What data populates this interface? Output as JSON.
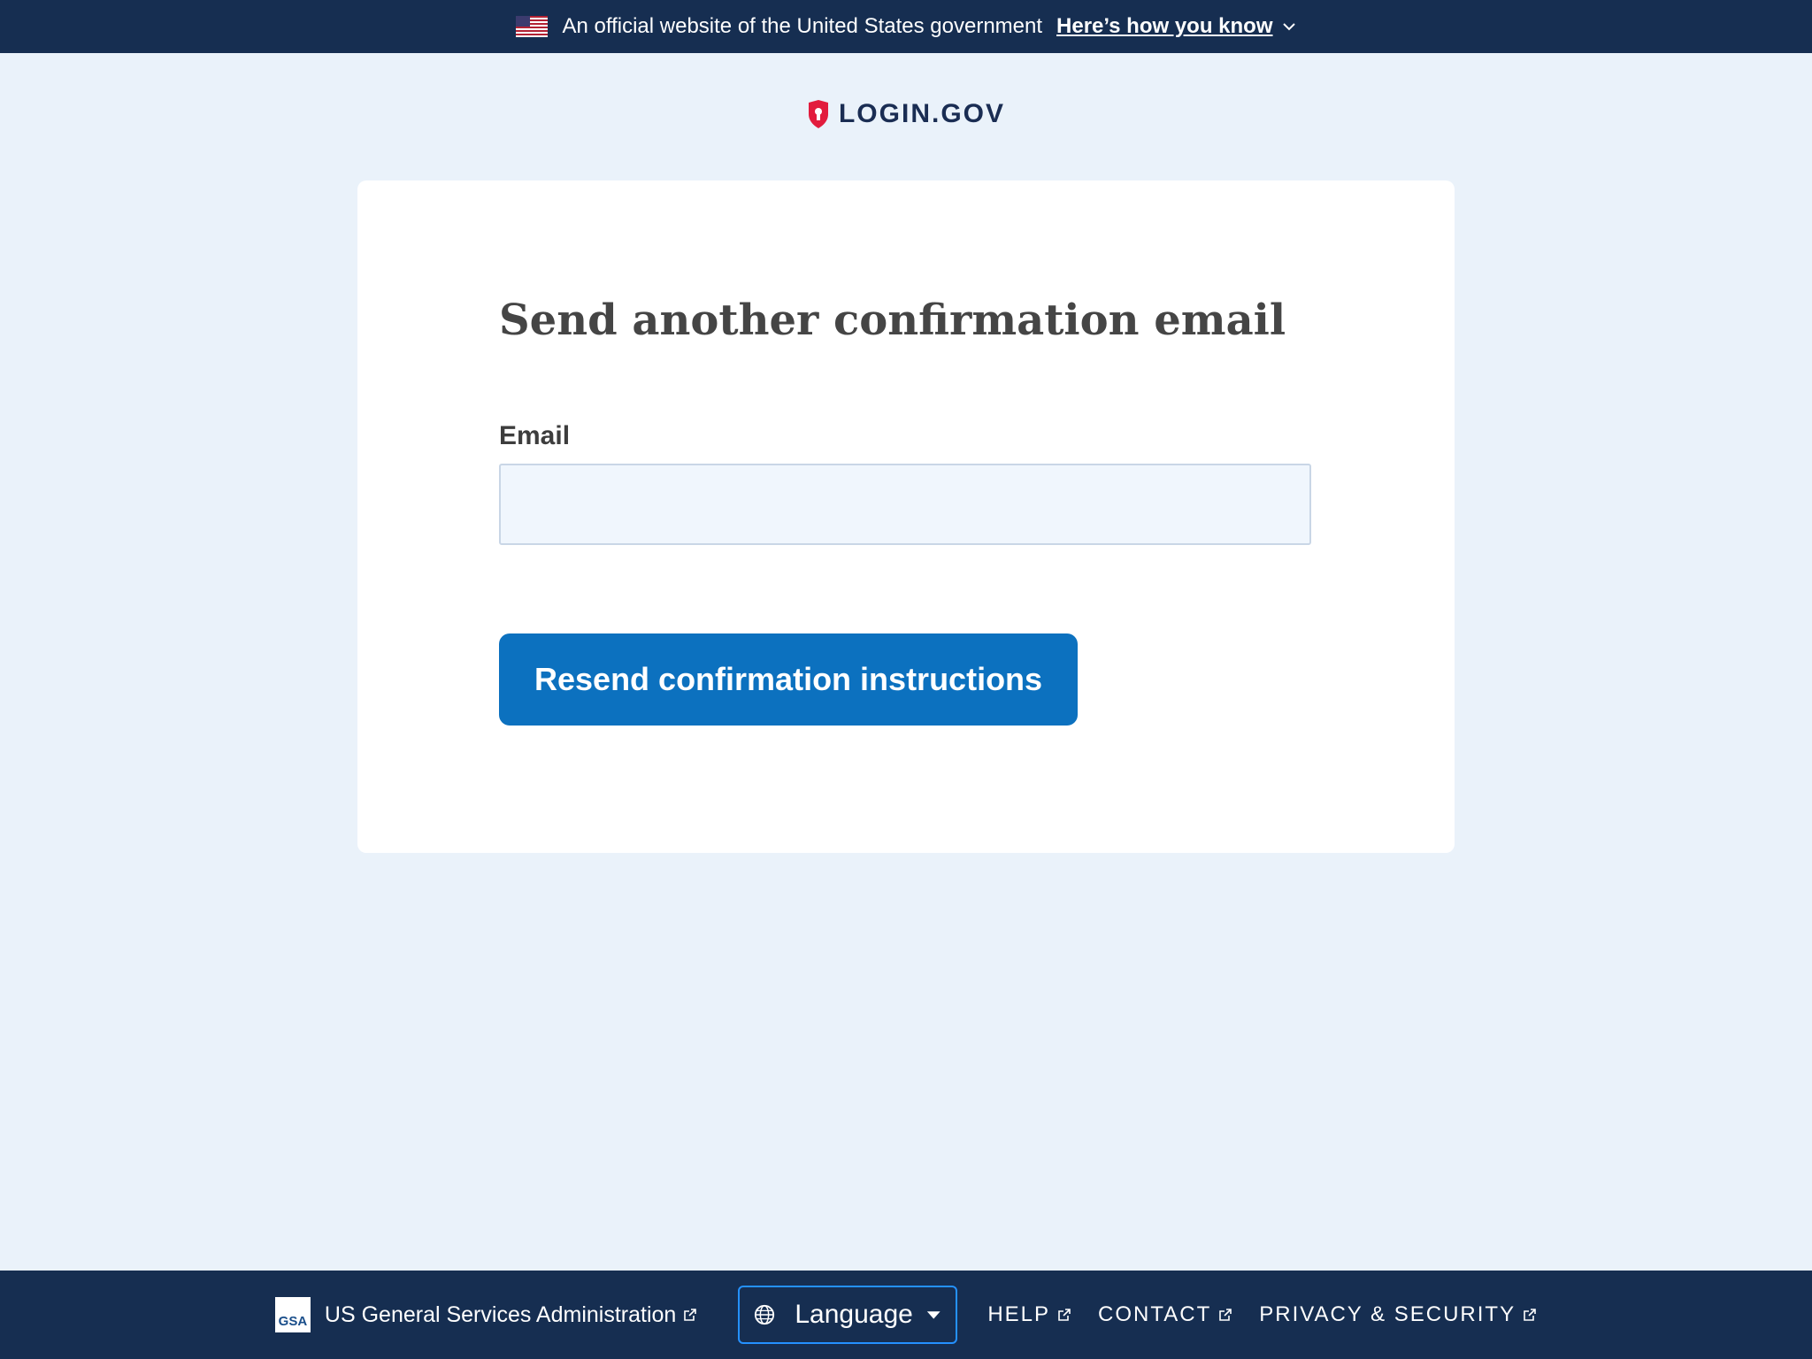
{
  "banner": {
    "text": "An official website of the United States government",
    "link_label": "Here’s how you know",
    "flag_icon": "us-flag-icon",
    "chevron_icon": "chevron-down-icon"
  },
  "logo": {
    "text": "LOGIN.GOV",
    "icon": "shield-keyhole-icon",
    "color": "#e21c3d"
  },
  "main": {
    "title": "Send another confirmation email",
    "email_label": "Email",
    "email_value": "",
    "submit_label": "Resend confirmation instructions"
  },
  "footer": {
    "gsa_logo_text": "GSA",
    "gsa_label": "US General Services Administration",
    "language_label": "Language",
    "links": [
      {
        "label": "HELP"
      },
      {
        "label": "CONTACT"
      },
      {
        "label": "PRIVACY & SECURITY"
      }
    ]
  },
  "colors": {
    "banner_bg": "#162e51",
    "page_bg": "#eaf2fa",
    "primary_button": "#0c71bf",
    "focus_outline": "#2491ff"
  }
}
